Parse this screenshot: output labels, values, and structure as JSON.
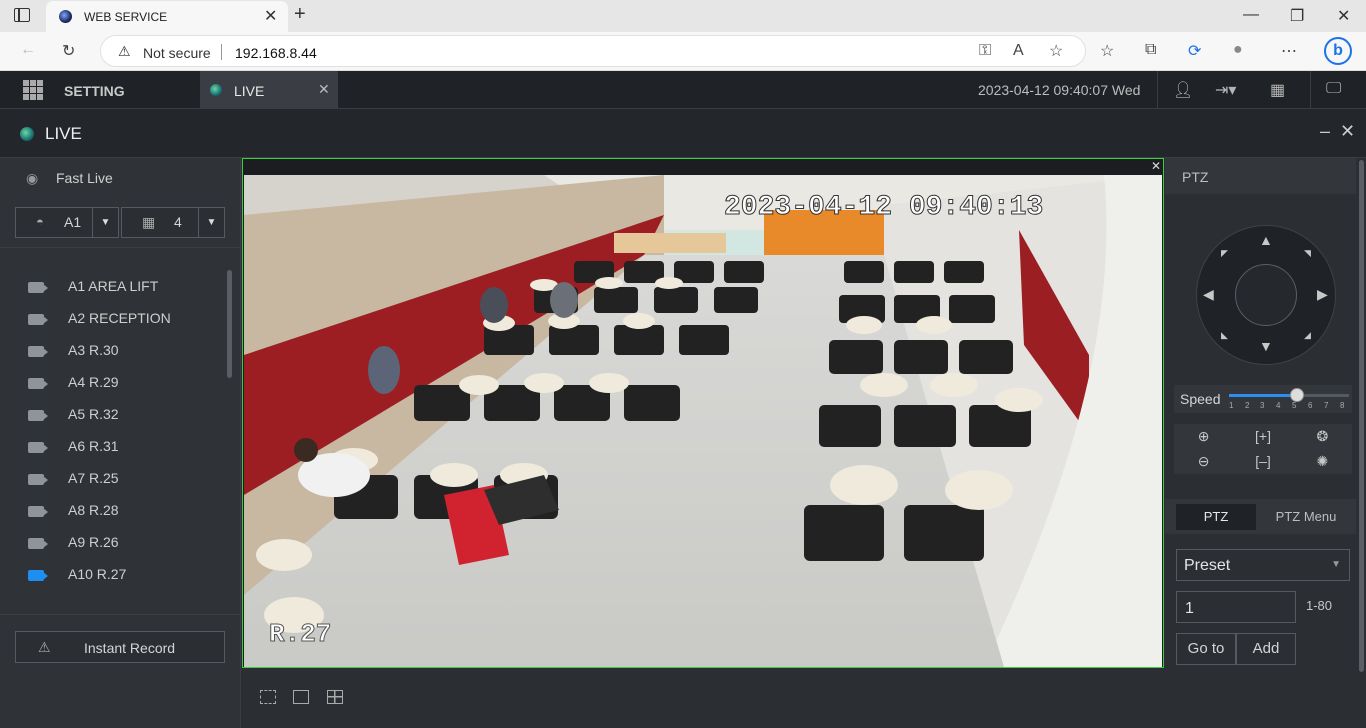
{
  "browser": {
    "tab_title": "WEB SERVICE",
    "security_label": "Not secure",
    "url": "192.168.8.44"
  },
  "header": {
    "setting_label": "SETTING",
    "live_tab_label": "LIVE",
    "datetime": "2023-04-12 09:40:07 Wed"
  },
  "live_title": "LIVE",
  "left_panel": {
    "fast_live_label": "Fast Live",
    "camera_select": "A1",
    "layout_select": "4",
    "channels": [
      {
        "label": "A1 AREA LIFT",
        "active": false
      },
      {
        "label": "A2 RECEPTION",
        "active": false
      },
      {
        "label": "A3 R.30",
        "active": false
      },
      {
        "label": "A4 R.29",
        "active": false
      },
      {
        "label": "A5 R.32",
        "active": false
      },
      {
        "label": "A6 R.31",
        "active": false
      },
      {
        "label": "A7 R.25",
        "active": false
      },
      {
        "label": "A8 R.28",
        "active": false
      },
      {
        "label": "A9 R.26",
        "active": false
      },
      {
        "label": "A10 R.27",
        "active": true
      }
    ],
    "instant_record_label": "Instant Record"
  },
  "video": {
    "osd_timestamp": "2023-04-12 09:40:13",
    "osd_channel": "R.27"
  },
  "ptz": {
    "title": "PTZ",
    "speed_label": "Speed",
    "speed_ticks": [
      "1",
      "2",
      "3",
      "4",
      "5",
      "6",
      "7",
      "8"
    ],
    "speed_value": 5,
    "tab_ptz": "PTZ",
    "tab_ptz_menu": "PTZ Menu",
    "preset_select": "Preset",
    "preset_number": "1",
    "preset_range": "1-80",
    "goto_label": "Go to",
    "add_label": "Add"
  },
  "colors": {
    "accent": "#1e8ef0",
    "video_border": "#3cd13c"
  }
}
